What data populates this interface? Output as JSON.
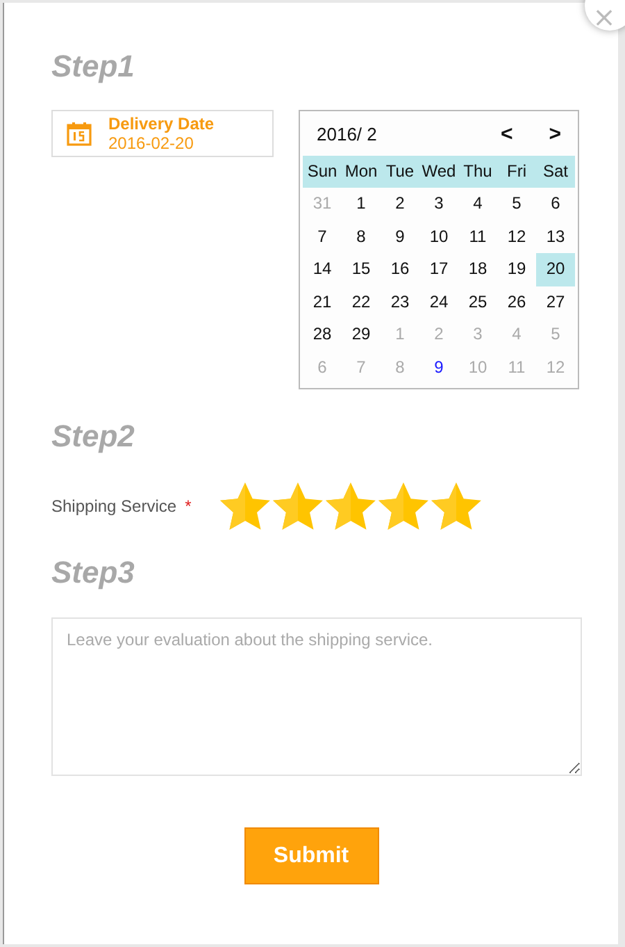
{
  "close_button": "×",
  "step1": {
    "title": "Step1",
    "date_field": {
      "label": "Delivery Date",
      "value": "2016-02-20"
    },
    "calendar": {
      "month": "2016/ 2",
      "prev": "<",
      "next": ">",
      "weekdays": [
        "Sun",
        "Mon",
        "Tue",
        "Wed",
        "Thu",
        "Fri",
        "Sat"
      ],
      "weeks": [
        [
          {
            "label": "31",
            "kind": "adjacent",
            "selected": false
          },
          {
            "label": "1",
            "kind": "current",
            "selected": false
          },
          {
            "label": "2",
            "kind": "current",
            "selected": false
          },
          {
            "label": "3",
            "kind": "current",
            "selected": false
          },
          {
            "label": "4",
            "kind": "current",
            "selected": false
          },
          {
            "label": "5",
            "kind": "current",
            "selected": false
          },
          {
            "label": "6",
            "kind": "current",
            "selected": false
          }
        ],
        [
          {
            "label": "7",
            "kind": "current",
            "selected": false
          },
          {
            "label": "8",
            "kind": "current",
            "selected": false
          },
          {
            "label": "9",
            "kind": "current",
            "selected": false
          },
          {
            "label": "10",
            "kind": "current",
            "selected": false
          },
          {
            "label": "11",
            "kind": "current",
            "selected": false
          },
          {
            "label": "12",
            "kind": "current",
            "selected": false
          },
          {
            "label": "13",
            "kind": "current",
            "selected": false
          }
        ],
        [
          {
            "label": "14",
            "kind": "current",
            "selected": false
          },
          {
            "label": "15",
            "kind": "current",
            "selected": false
          },
          {
            "label": "16",
            "kind": "current",
            "selected": false
          },
          {
            "label": "17",
            "kind": "current",
            "selected": false
          },
          {
            "label": "18",
            "kind": "current",
            "selected": false
          },
          {
            "label": "19",
            "kind": "current",
            "selected": false
          },
          {
            "label": "20",
            "kind": "current",
            "selected": true
          }
        ],
        [
          {
            "label": "21",
            "kind": "current",
            "selected": false
          },
          {
            "label": "22",
            "kind": "current",
            "selected": false
          },
          {
            "label": "23",
            "kind": "current",
            "selected": false
          },
          {
            "label": "24",
            "kind": "current",
            "selected": false
          },
          {
            "label": "25",
            "kind": "current",
            "selected": false
          },
          {
            "label": "26",
            "kind": "current",
            "selected": false
          },
          {
            "label": "27",
            "kind": "current",
            "selected": false
          }
        ],
        [
          {
            "label": "28",
            "kind": "current",
            "selected": false
          },
          {
            "label": "29",
            "kind": "current",
            "selected": false
          },
          {
            "label": "1",
            "kind": "adjacent",
            "selected": false
          },
          {
            "label": "2",
            "kind": "adjacent",
            "selected": false
          },
          {
            "label": "3",
            "kind": "adjacent",
            "selected": false
          },
          {
            "label": "4",
            "kind": "adjacent",
            "selected": false
          },
          {
            "label": "5",
            "kind": "adjacent",
            "selected": false
          }
        ],
        [
          {
            "label": "6",
            "kind": "adjacent",
            "selected": false
          },
          {
            "label": "7",
            "kind": "adjacent",
            "selected": false
          },
          {
            "label": "8",
            "kind": "adjacent",
            "selected": false
          },
          {
            "label": "9",
            "kind": "marked",
            "selected": false
          },
          {
            "label": "10",
            "kind": "adjacent",
            "selected": false
          },
          {
            "label": "11",
            "kind": "adjacent",
            "selected": false
          },
          {
            "label": "12",
            "kind": "adjacent",
            "selected": false
          }
        ]
      ]
    }
  },
  "step2": {
    "title": "Step2",
    "rating": {
      "label": "Shipping Service",
      "required_mark": "*",
      "stars": 5
    }
  },
  "step3": {
    "title": "Step3",
    "comment": {
      "placeholder": "Leave your evaluation about the shipping service."
    }
  },
  "submit": "Submit"
}
